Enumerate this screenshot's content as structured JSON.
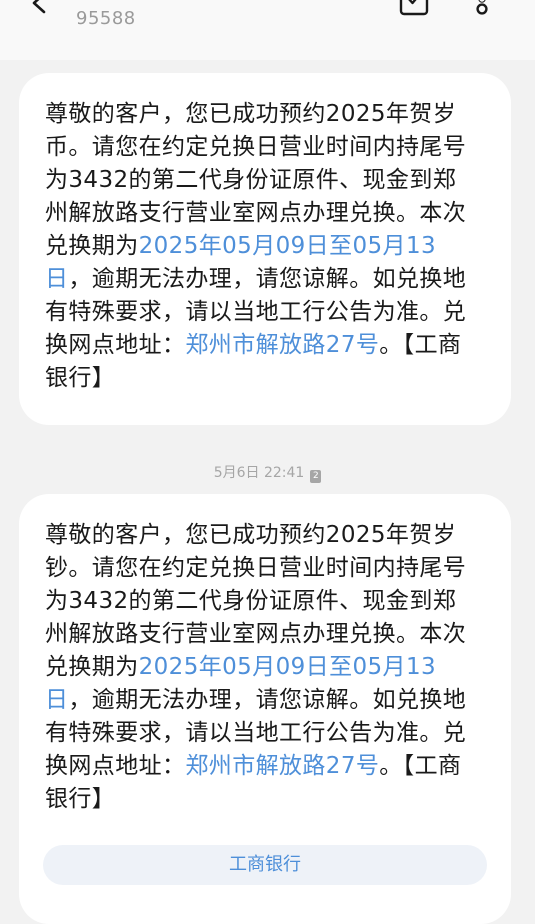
{
  "header": {
    "sender_number": "95588"
  },
  "messages": [
    {
      "lines": [
        {
          "segments": [
            {
              "text": "尊敬的客户，您已成功预约2025年贺岁",
              "link": false
            }
          ]
        },
        {
          "segments": [
            {
              "text": "币。请您在约定兑换日营业时间内持尾号",
              "link": false
            }
          ]
        },
        {
          "segments": [
            {
              "text": "为3432的第二代身份证原件、现金到郑",
              "link": false
            }
          ]
        },
        {
          "segments": [
            {
              "text": "州解放路支行营业室网点办理兑换。本次",
              "link": false
            }
          ]
        },
        {
          "segments": [
            {
              "text": "兑换期为",
              "link": false
            },
            {
              "text": "2025年05月09日至05月13",
              "link": true
            }
          ]
        },
        {
          "segments": [
            {
              "text": "日",
              "link": true
            },
            {
              "text": "，逾期无法办理，请您谅解。如兑换地",
              "link": false
            }
          ]
        },
        {
          "segments": [
            {
              "text": "有特殊要求，请以当地工行公告为准。兑",
              "link": false
            }
          ]
        },
        {
          "segments": [
            {
              "text": "换网点地址：",
              "link": false
            },
            {
              "text": "郑州市解放路27号",
              "link": true
            },
            {
              "text": "。【工商",
              "link": false
            }
          ]
        },
        {
          "segments": [
            {
              "text": "银行】",
              "link": false
            }
          ]
        }
      ]
    },
    {
      "timestamp": "5月6日 22:41",
      "sim_badge": "2",
      "lines": [
        {
          "segments": [
            {
              "text": "尊敬的客户，您已成功预约2025年贺岁",
              "link": false
            }
          ]
        },
        {
          "segments": [
            {
              "text": "钞。请您在约定兑换日营业时间内持尾号",
              "link": false
            }
          ]
        },
        {
          "segments": [
            {
              "text": "为3432的第二代身份证原件、现金到郑",
              "link": false
            }
          ]
        },
        {
          "segments": [
            {
              "text": "州解放路支行营业室网点办理兑换。本次",
              "link": false
            }
          ]
        },
        {
          "segments": [
            {
              "text": "兑换期为",
              "link": false
            },
            {
              "text": "2025年05月09日至05月13",
              "link": true
            }
          ]
        },
        {
          "segments": [
            {
              "text": "日",
              "link": true
            },
            {
              "text": "，逾期无法办理，请您谅解。如兑换地",
              "link": false
            }
          ]
        },
        {
          "segments": [
            {
              "text": "有特殊要求，请以当地工行公告为准。兑",
              "link": false
            }
          ]
        },
        {
          "segments": [
            {
              "text": "换网点地址：",
              "link": false
            },
            {
              "text": "郑州市解放路27号",
              "link": true
            },
            {
              "text": "。【工商",
              "link": false
            }
          ]
        },
        {
          "segments": [
            {
              "text": "银行】",
              "link": false
            }
          ]
        }
      ],
      "quick_action": "工商银行"
    }
  ],
  "colors": {
    "link": "#4e8fd9",
    "background": "#f2f2f2",
    "bubble": "#ffffff"
  },
  "icons": {
    "back": "back-arrow-icon",
    "task": "calendar-check-icon",
    "more": "more-vertical-icon"
  }
}
